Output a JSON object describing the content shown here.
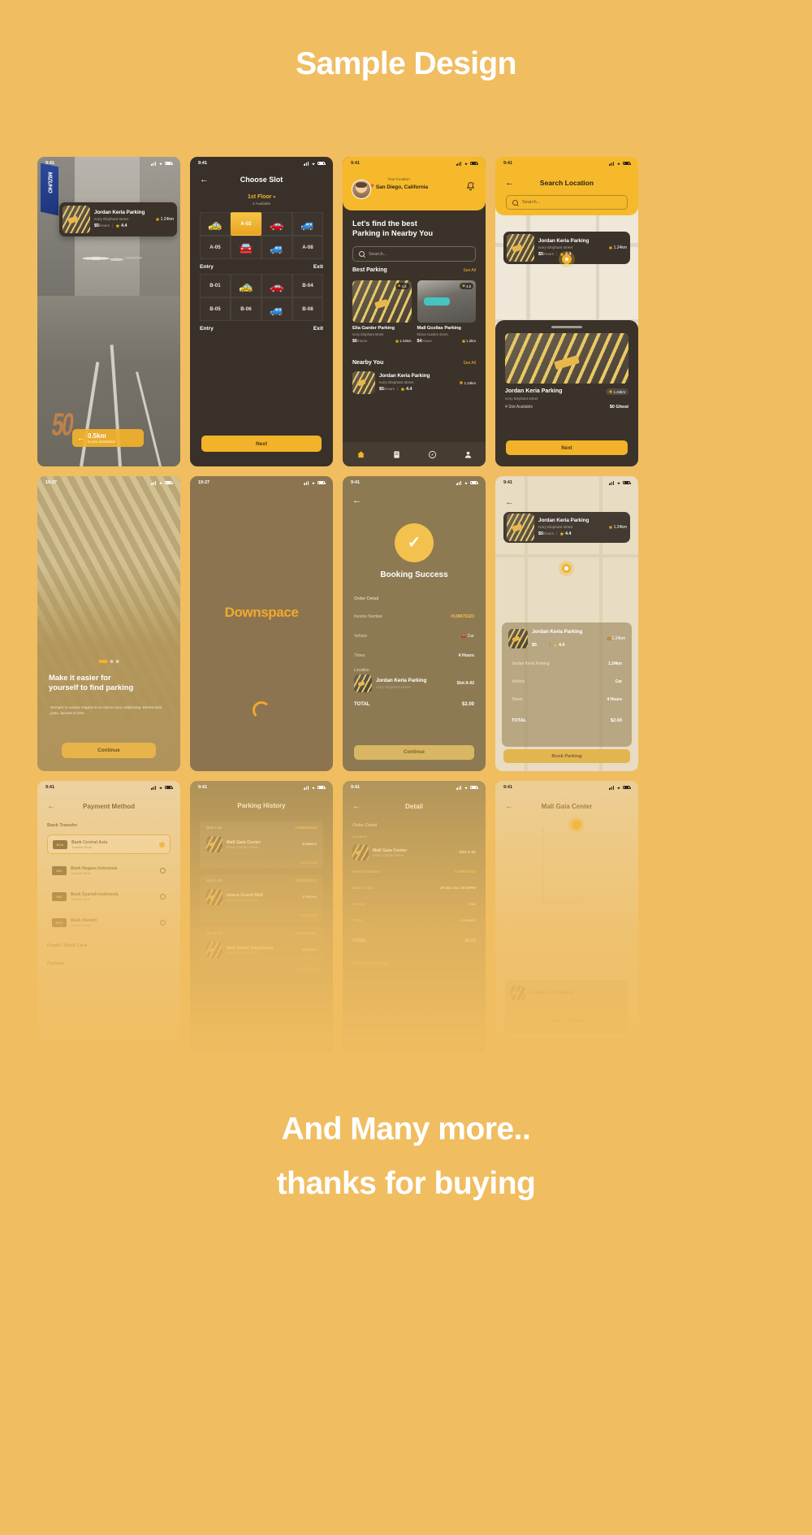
{
  "header": {
    "title": "Sample Design"
  },
  "footer": {
    "line1": "And Many more..",
    "line2": "thanks for buying"
  },
  "statusbar": {
    "time_941": "9:41",
    "time_1927": "19:27"
  },
  "colors": {
    "brand_bg": "#f0bd60",
    "accent": "#f2b229",
    "dark": "#3b322a",
    "light": "#efe8d9"
  },
  "screens": {
    "map_detail": {
      "parking": {
        "name": "Jordan Keria Parking",
        "street": "Ivory Elephant street",
        "price": "$5",
        "price_unit": "/Hours",
        "divider": "|",
        "rating": "4.4",
        "distance": "1.24km"
      },
      "distance_badge": {
        "value": "0.5km",
        "caption": "to your destination"
      },
      "road_marking": "50",
      "billboard": "MIZUHO"
    },
    "choose_slot": {
      "title": "Choose Slot",
      "floor": "1st Floor",
      "floor_caret": "▾",
      "available": "4 Available",
      "rows": [
        [
          {
            "label": "",
            "icon": "car-yellow"
          },
          {
            "label": "A-02",
            "icon": ""
          },
          {
            "label": "",
            "icon": "car-orange"
          },
          {
            "label": "",
            "icon": "car-teal"
          }
        ],
        [
          {
            "label": "A-05",
            "icon": ""
          },
          {
            "label": "",
            "icon": "car-grey"
          },
          {
            "label": "",
            "icon": "car-teal"
          },
          {
            "label": "A-08",
            "icon": ""
          }
        ]
      ],
      "rows_b": [
        [
          {
            "label": "B-01",
            "icon": ""
          },
          {
            "label": "",
            "icon": "car-yellow"
          },
          {
            "label": "",
            "icon": "car-orange"
          },
          {
            "label": "B-04",
            "icon": ""
          }
        ],
        [
          {
            "label": "B-05",
            "icon": ""
          },
          {
            "label": "B-06",
            "icon": ""
          },
          {
            "label": "",
            "icon": "car-teal"
          },
          {
            "label": "B-08",
            "icon": ""
          }
        ]
      ],
      "entry_label": "Entry",
      "exit_label": "Exit",
      "next_label": "Next"
    },
    "home": {
      "location_caption": "Your location",
      "location_value": "San Diego, California",
      "headline_1": "Let's find the best",
      "headline_2": "Parking in Nearby You",
      "search_placeholder": "Search...",
      "best_parking_title": "Best Parking",
      "see_all": "See All",
      "best_cards": [
        {
          "name": "Elia Garder Parking",
          "street": "Ivory Elephant street",
          "price": "$6",
          "unit": "/Hours",
          "distance": "1.24km",
          "rating": "4.3"
        },
        {
          "name": "Mall Gozilas Parking",
          "street": "Elisan Garden street",
          "price": "$4",
          "unit": "/Hours",
          "distance": "1.2km",
          "rating": "4.5"
        }
      ],
      "nearby_title": "Nearby You",
      "nearby": [
        {
          "name": "Jordan Keria Parking",
          "street": "Ivory Elephant street",
          "price": "$5",
          "unit": "/Hours",
          "rating": "4.4",
          "distance": "1.24km"
        }
      ],
      "tabs": [
        "home-icon",
        "ticket-icon",
        "compass-icon",
        "profile-icon"
      ]
    },
    "search_location": {
      "title": "Search Location",
      "search_placeholder": "Search...",
      "card": {
        "name": "Jordan Keria Parking",
        "street": "Ivory Elephant street",
        "price": "$5",
        "unit": "/Hours",
        "rating": "4.4",
        "distance": "1.24km"
      },
      "sheet": {
        "name": "Jordan Keria Parking",
        "street": "Ivory Elephant street",
        "distance": "1.24km",
        "slots": "4 Slot Available",
        "ghost": "$0 Ghost",
        "next_label": "Next"
      }
    },
    "onboarding": {
      "headline_1": "Make it easier for",
      "headline_2": "yourself to find parking",
      "body": "Semper in cursus magna et eu varius nunc adipiscing. Elementum justo, laoreet id sem",
      "button": "Continue"
    },
    "splash": {
      "wordmark": "Downspace"
    },
    "booking_success": {
      "title": "Booking Success",
      "section": "Order Detail",
      "rows": [
        {
          "label": "Invoice Number",
          "value": "#139675323"
        },
        {
          "label": "Vehicle",
          "value": "Car"
        },
        {
          "label": "Times",
          "value": "4 Hours"
        }
      ],
      "location_label": "Location",
      "location_name": "Jordan Keria Parking",
      "location_street": "Ivory Elephant street",
      "slot": "Slot A-02",
      "total_label": "TOTAL",
      "total_value": "$2.00",
      "button": "Continue"
    },
    "book_parking": {
      "card": {
        "name": "Jordan Keria Parking",
        "street": "Ivory Elephant street",
        "price": "$5",
        "unit": "/Hours",
        "rating": "4.4",
        "distance": "1.24km"
      },
      "detail": {
        "name": "Jordan Keria Parking",
        "street": "Ivory Elephant street",
        "distance": "1.24km",
        "rows": [
          {
            "label": "Jordan Keria Parking",
            "value": "1.24km"
          },
          {
            "label": "Vehicle",
            "value": "Car"
          },
          {
            "label": "Times",
            "value": "4 Hours"
          }
        ],
        "total_label": "TOTAL",
        "total_value": "$2.00"
      },
      "button": "Book Parking"
    },
    "payment_method": {
      "title": "Payment Method",
      "group_1": "Bank Transfer",
      "banks": [
        {
          "logo": "BCA",
          "name": "Bank Central Asia",
          "sub": "Transfer Bank",
          "selected": true
        },
        {
          "logo": "BNI",
          "name": "Bank Negara Indonesia",
          "sub": "Transfer Bank",
          "selected": false
        },
        {
          "logo": "BSI",
          "name": "Bank Syariah Indonesia",
          "sub": "Transfer Bank",
          "selected": false
        },
        {
          "logo": "MDR",
          "name": "Bank Mandiri",
          "sub": "Transfer Bank",
          "selected": false
        }
      ],
      "group_2": "Credit / Debit Card",
      "group_3": "Paylater"
    },
    "parking_history": {
      "title": "Parking History",
      "items": [
        {
          "slot": "Slot A-02",
          "invoice": "#139675323",
          "name": "Mall Gaia Center",
          "duration": "4 Hours",
          "link": "See Detail"
        },
        {
          "slot": "Slot A-09",
          "invoice": "#139675123",
          "name": "Istana Grand Mall",
          "duration": "3 Hours",
          "link": "See Detail"
        },
        {
          "slot": "Slot B-01",
          "invoice": "#139675991",
          "name": "Mall Grand Sagabrang",
          "duration": "5 Hours",
          "link": "See Detail"
        }
      ]
    },
    "detail": {
      "title": "Detail",
      "section": "Order Detail",
      "location_label": "Location",
      "place": "Mall Gaia Center",
      "slot": "Slot A-02",
      "rows": [
        {
          "label": "Invoice Number",
          "value": "#139675323"
        },
        {
          "label": "Date & Time",
          "value": "20 Mar 22, 18:00PM"
        },
        {
          "label": "Vehicle",
          "value": "Car"
        },
        {
          "label": "Times",
          "value": "4 Hours"
        }
      ],
      "total_label": "TOTAL",
      "total_value": "$2.00",
      "footer": "Mall Gaia Center Area"
    },
    "mall_map": {
      "title": "Mall Gaia Center",
      "card_name": "Jordan Keria Parking",
      "card_sub": "A. 20 minute from you car",
      "card_action": "Navigate to Parking"
    }
  }
}
